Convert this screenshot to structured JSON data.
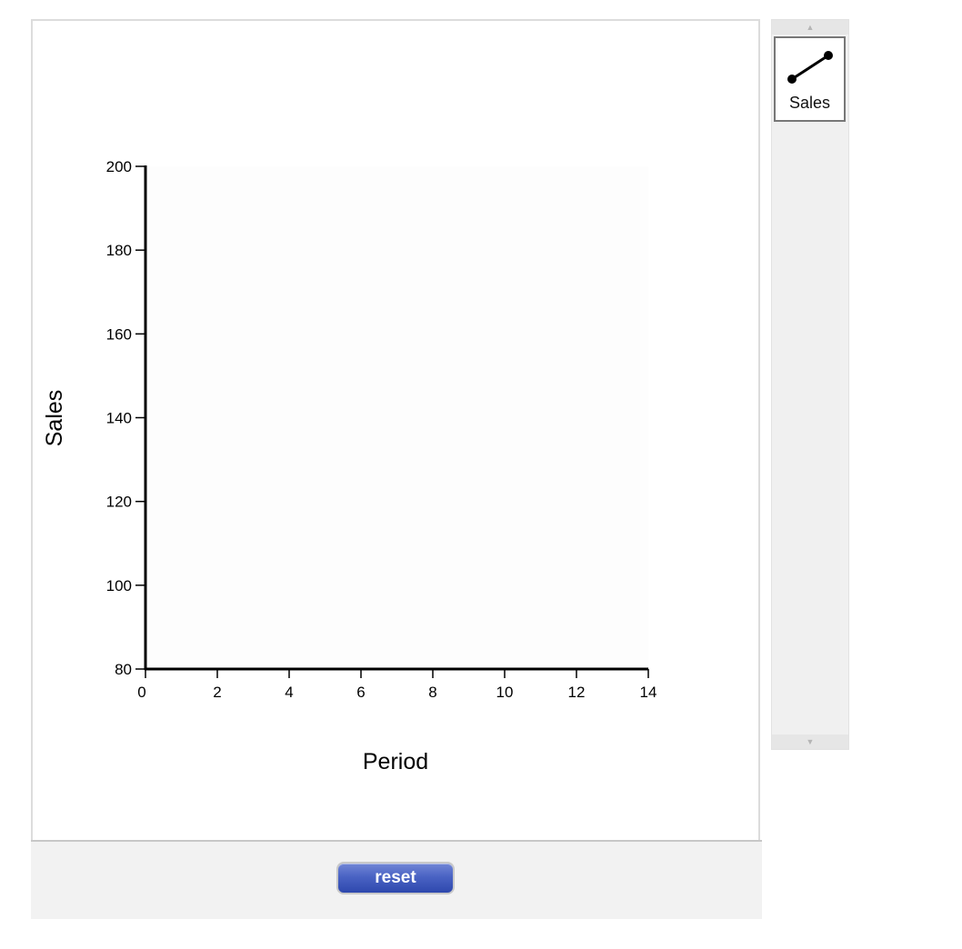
{
  "chart_data": {
    "type": "line",
    "title": "",
    "xlabel": "Period",
    "ylabel": "Sales",
    "xlim": [
      0,
      14
    ],
    "ylim": [
      80,
      200
    ],
    "x_ticks": [
      0,
      2,
      4,
      6,
      8,
      10,
      12,
      14
    ],
    "y_ticks": [
      80,
      100,
      120,
      140,
      160,
      180,
      200
    ],
    "series": [
      {
        "name": "Sales",
        "points": []
      }
    ],
    "grid": false
  },
  "toolbox": {
    "items": [
      {
        "label": "Sales",
        "icon": "line-segment-icon"
      }
    ],
    "scroll_up_icon": "scroll-up-arrow-icon",
    "scroll_down_icon": "scroll-down-arrow-icon"
  },
  "controls": {
    "reset_label": "reset"
  },
  "colors": {
    "reset_button": "#4a63c4",
    "plot_background": "#fdfdfd",
    "axis": "#000000"
  }
}
